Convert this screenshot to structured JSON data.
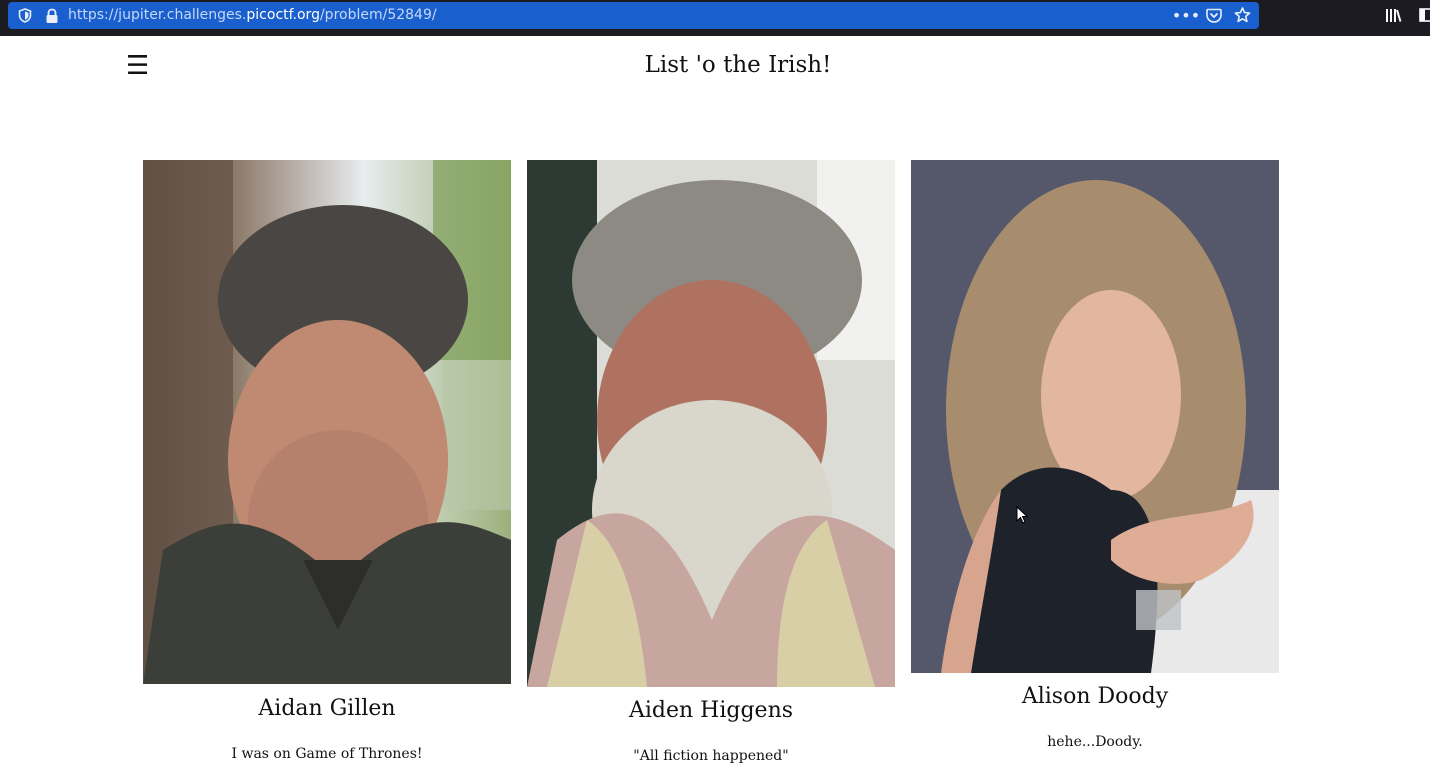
{
  "browser": {
    "url_prefix": "https://jupiter.challenges.",
    "url_host": "picoctf.org",
    "url_path": "/problem/52849/",
    "more_icon": "ellipsis-icon",
    "pocket_icon": "pocket-icon",
    "bookmark_icon": "star-icon"
  },
  "page": {
    "menu_glyph": "☰",
    "title": "List 'o the Irish!"
  },
  "people": [
    {
      "name": "Aidan Gillen",
      "quote": "I was on Game of Thrones!"
    },
    {
      "name": "Aiden Higgens",
      "quote": "\"All fiction happened\""
    },
    {
      "name": "Alison Doody",
      "quote": "hehe...Doody."
    }
  ]
}
